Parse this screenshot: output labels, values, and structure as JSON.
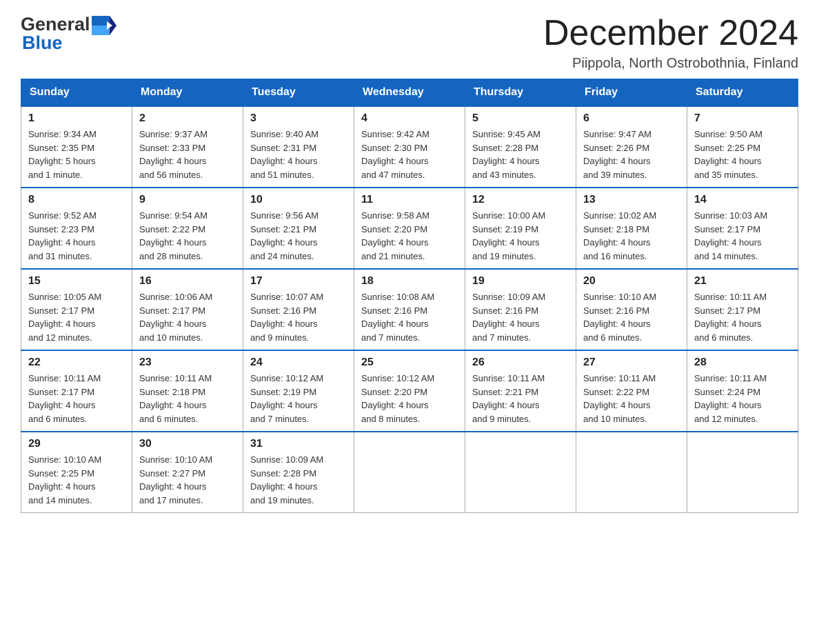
{
  "header": {
    "logo_general": "General",
    "logo_blue": "Blue",
    "month_title": "December 2024",
    "subtitle": "Piippola, North Ostrobothnia, Finland"
  },
  "days_of_week": [
    "Sunday",
    "Monday",
    "Tuesday",
    "Wednesday",
    "Thursday",
    "Friday",
    "Saturday"
  ],
  "weeks": [
    [
      {
        "day": "1",
        "sunrise": "Sunrise: 9:34 AM",
        "sunset": "Sunset: 2:35 PM",
        "daylight": "Daylight: 5 hours",
        "daylight2": "and 1 minute."
      },
      {
        "day": "2",
        "sunrise": "Sunrise: 9:37 AM",
        "sunset": "Sunset: 2:33 PM",
        "daylight": "Daylight: 4 hours",
        "daylight2": "and 56 minutes."
      },
      {
        "day": "3",
        "sunrise": "Sunrise: 9:40 AM",
        "sunset": "Sunset: 2:31 PM",
        "daylight": "Daylight: 4 hours",
        "daylight2": "and 51 minutes."
      },
      {
        "day": "4",
        "sunrise": "Sunrise: 9:42 AM",
        "sunset": "Sunset: 2:30 PM",
        "daylight": "Daylight: 4 hours",
        "daylight2": "and 47 minutes."
      },
      {
        "day": "5",
        "sunrise": "Sunrise: 9:45 AM",
        "sunset": "Sunset: 2:28 PM",
        "daylight": "Daylight: 4 hours",
        "daylight2": "and 43 minutes."
      },
      {
        "day": "6",
        "sunrise": "Sunrise: 9:47 AM",
        "sunset": "Sunset: 2:26 PM",
        "daylight": "Daylight: 4 hours",
        "daylight2": "and 39 minutes."
      },
      {
        "day": "7",
        "sunrise": "Sunrise: 9:50 AM",
        "sunset": "Sunset: 2:25 PM",
        "daylight": "Daylight: 4 hours",
        "daylight2": "and 35 minutes."
      }
    ],
    [
      {
        "day": "8",
        "sunrise": "Sunrise: 9:52 AM",
        "sunset": "Sunset: 2:23 PM",
        "daylight": "Daylight: 4 hours",
        "daylight2": "and 31 minutes."
      },
      {
        "day": "9",
        "sunrise": "Sunrise: 9:54 AM",
        "sunset": "Sunset: 2:22 PM",
        "daylight": "Daylight: 4 hours",
        "daylight2": "and 28 minutes."
      },
      {
        "day": "10",
        "sunrise": "Sunrise: 9:56 AM",
        "sunset": "Sunset: 2:21 PM",
        "daylight": "Daylight: 4 hours",
        "daylight2": "and 24 minutes."
      },
      {
        "day": "11",
        "sunrise": "Sunrise: 9:58 AM",
        "sunset": "Sunset: 2:20 PM",
        "daylight": "Daylight: 4 hours",
        "daylight2": "and 21 minutes."
      },
      {
        "day": "12",
        "sunrise": "Sunrise: 10:00 AM",
        "sunset": "Sunset: 2:19 PM",
        "daylight": "Daylight: 4 hours",
        "daylight2": "and 19 minutes."
      },
      {
        "day": "13",
        "sunrise": "Sunrise: 10:02 AM",
        "sunset": "Sunset: 2:18 PM",
        "daylight": "Daylight: 4 hours",
        "daylight2": "and 16 minutes."
      },
      {
        "day": "14",
        "sunrise": "Sunrise: 10:03 AM",
        "sunset": "Sunset: 2:17 PM",
        "daylight": "Daylight: 4 hours",
        "daylight2": "and 14 minutes."
      }
    ],
    [
      {
        "day": "15",
        "sunrise": "Sunrise: 10:05 AM",
        "sunset": "Sunset: 2:17 PM",
        "daylight": "Daylight: 4 hours",
        "daylight2": "and 12 minutes."
      },
      {
        "day": "16",
        "sunrise": "Sunrise: 10:06 AM",
        "sunset": "Sunset: 2:17 PM",
        "daylight": "Daylight: 4 hours",
        "daylight2": "and 10 minutes."
      },
      {
        "day": "17",
        "sunrise": "Sunrise: 10:07 AM",
        "sunset": "Sunset: 2:16 PM",
        "daylight": "Daylight: 4 hours",
        "daylight2": "and 9 minutes."
      },
      {
        "day": "18",
        "sunrise": "Sunrise: 10:08 AM",
        "sunset": "Sunset: 2:16 PM",
        "daylight": "Daylight: 4 hours",
        "daylight2": "and 7 minutes."
      },
      {
        "day": "19",
        "sunrise": "Sunrise: 10:09 AM",
        "sunset": "Sunset: 2:16 PM",
        "daylight": "Daylight: 4 hours",
        "daylight2": "and 7 minutes."
      },
      {
        "day": "20",
        "sunrise": "Sunrise: 10:10 AM",
        "sunset": "Sunset: 2:16 PM",
        "daylight": "Daylight: 4 hours",
        "daylight2": "and 6 minutes."
      },
      {
        "day": "21",
        "sunrise": "Sunrise: 10:11 AM",
        "sunset": "Sunset: 2:17 PM",
        "daylight": "Daylight: 4 hours",
        "daylight2": "and 6 minutes."
      }
    ],
    [
      {
        "day": "22",
        "sunrise": "Sunrise: 10:11 AM",
        "sunset": "Sunset: 2:17 PM",
        "daylight": "Daylight: 4 hours",
        "daylight2": "and 6 minutes."
      },
      {
        "day": "23",
        "sunrise": "Sunrise: 10:11 AM",
        "sunset": "Sunset: 2:18 PM",
        "daylight": "Daylight: 4 hours",
        "daylight2": "and 6 minutes."
      },
      {
        "day": "24",
        "sunrise": "Sunrise: 10:12 AM",
        "sunset": "Sunset: 2:19 PM",
        "daylight": "Daylight: 4 hours",
        "daylight2": "and 7 minutes."
      },
      {
        "day": "25",
        "sunrise": "Sunrise: 10:12 AM",
        "sunset": "Sunset: 2:20 PM",
        "daylight": "Daylight: 4 hours",
        "daylight2": "and 8 minutes."
      },
      {
        "day": "26",
        "sunrise": "Sunrise: 10:11 AM",
        "sunset": "Sunset: 2:21 PM",
        "daylight": "Daylight: 4 hours",
        "daylight2": "and 9 minutes."
      },
      {
        "day": "27",
        "sunrise": "Sunrise: 10:11 AM",
        "sunset": "Sunset: 2:22 PM",
        "daylight": "Daylight: 4 hours",
        "daylight2": "and 10 minutes."
      },
      {
        "day": "28",
        "sunrise": "Sunrise: 10:11 AM",
        "sunset": "Sunset: 2:24 PM",
        "daylight": "Daylight: 4 hours",
        "daylight2": "and 12 minutes."
      }
    ],
    [
      {
        "day": "29",
        "sunrise": "Sunrise: 10:10 AM",
        "sunset": "Sunset: 2:25 PM",
        "daylight": "Daylight: 4 hours",
        "daylight2": "and 14 minutes."
      },
      {
        "day": "30",
        "sunrise": "Sunrise: 10:10 AM",
        "sunset": "Sunset: 2:27 PM",
        "daylight": "Daylight: 4 hours",
        "daylight2": "and 17 minutes."
      },
      {
        "day": "31",
        "sunrise": "Sunrise: 10:09 AM",
        "sunset": "Sunset: 2:28 PM",
        "daylight": "Daylight: 4 hours",
        "daylight2": "and 19 minutes."
      },
      null,
      null,
      null,
      null
    ]
  ]
}
